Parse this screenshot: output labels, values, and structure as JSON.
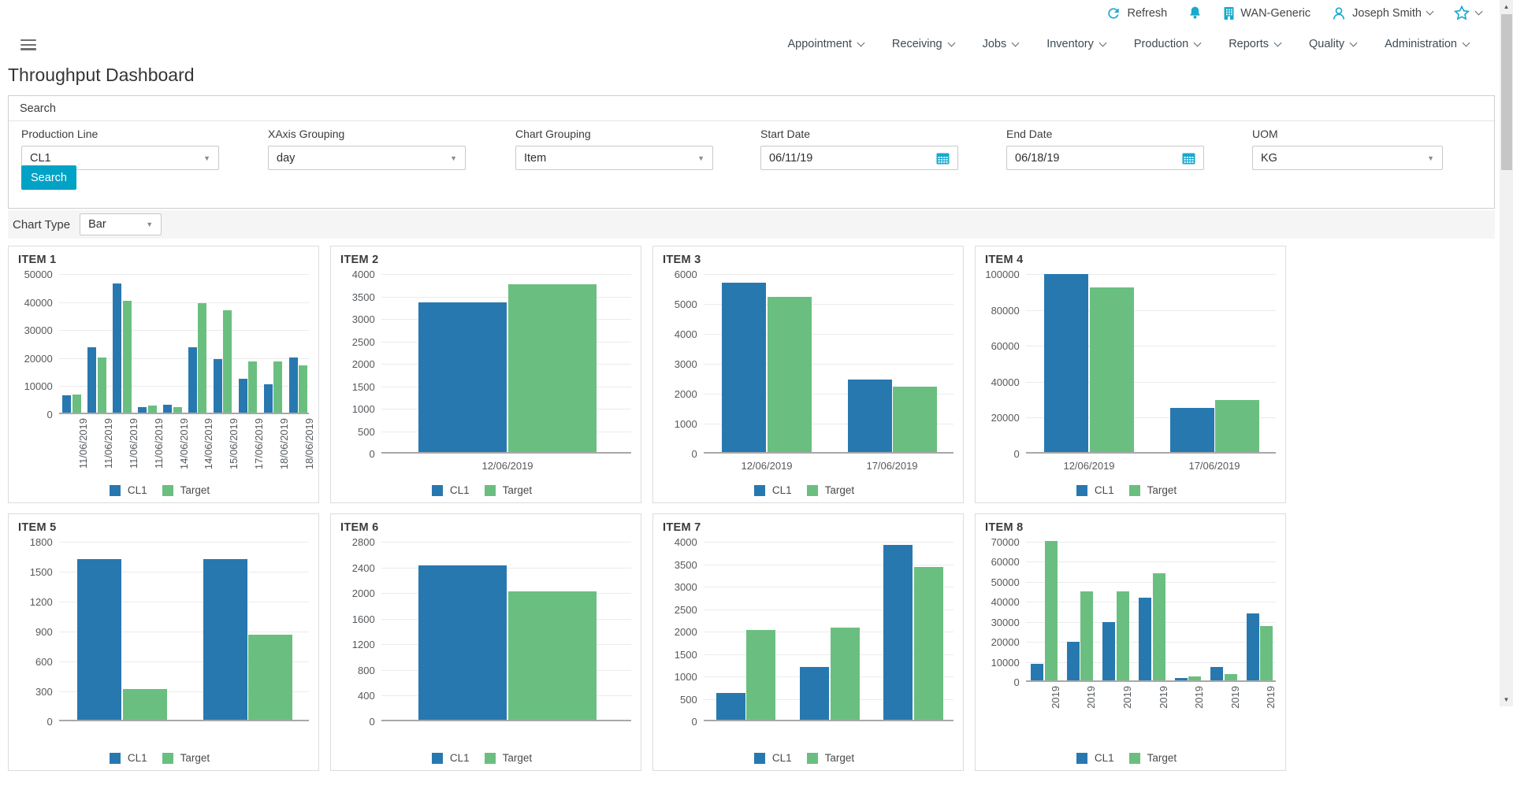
{
  "colors": {
    "accent": "#00a2c6",
    "bar_blue": "#2878b0",
    "bar_green": "#6abf80"
  },
  "topbar": {
    "refresh_label": "Refresh",
    "site_label": "WAN-Generic",
    "user_name": "Joseph Smith",
    "nav": [
      "Appointment",
      "Receiving",
      "Jobs",
      "Inventory",
      "Production",
      "Reports",
      "Quality",
      "Administration"
    ]
  },
  "page": {
    "title": "Throughput Dashboard"
  },
  "search_panel": {
    "header": "Search",
    "fields": [
      {
        "label": "Production Line",
        "value": "CL1",
        "type": "select"
      },
      {
        "label": "XAxis Grouping",
        "value": "day",
        "type": "select"
      },
      {
        "label": "Chart Grouping",
        "value": "Item",
        "type": "select"
      },
      {
        "label": "Start Date",
        "value": "06/11/19",
        "type": "date"
      },
      {
        "label": "End Date",
        "value": "06/18/19",
        "type": "date"
      },
      {
        "label": "UOM",
        "value": "KG",
        "type": "select"
      }
    ],
    "search_button": "Search"
  },
  "chart_type": {
    "label": "Chart Type",
    "value": "Bar"
  },
  "chart_data": [
    {
      "type": "bar",
      "title": "ITEM 1",
      "ylim": [
        0,
        50000
      ],
      "ystep": 10000,
      "rotated_labels": true,
      "grid": true,
      "legend_position": "bottom",
      "categories": [
        "11/06/2019",
        "11/06/2019",
        "11/06/2019",
        "11/06/2019",
        "14/06/2019",
        "14/06/2019",
        "15/06/2019",
        "17/06/2019",
        "18/06/2019",
        "18/06/2019"
      ],
      "series": [
        {
          "name": "CL1",
          "values": [
            6200,
            23200,
            46000,
            1900,
            2900,
            23400,
            19000,
            12000,
            10000,
            19800
          ]
        },
        {
          "name": "Target",
          "values": [
            6600,
            19800,
            39800,
            2600,
            2000,
            39100,
            36500,
            18300,
            18300,
            16800
          ]
        }
      ]
    },
    {
      "type": "bar",
      "title": "ITEM 2",
      "ylim": [
        0,
        4000
      ],
      "ystep": 500,
      "rotated_labels": false,
      "grid": true,
      "legend_position": "bottom",
      "categories": [
        "12/06/2019"
      ],
      "series": [
        {
          "name": "CL1",
          "values": [
            3330
          ]
        },
        {
          "name": "Target",
          "values": [
            3730
          ]
        }
      ]
    },
    {
      "type": "bar",
      "title": "ITEM 3",
      "ylim": [
        0,
        6000
      ],
      "ystep": 1000,
      "rotated_labels": false,
      "grid": true,
      "legend_position": "bottom",
      "categories": [
        "12/06/2019",
        "17/06/2019"
      ],
      "series": [
        {
          "name": "CL1",
          "values": [
            5650,
            2420
          ]
        },
        {
          "name": "Target",
          "values": [
            5180,
            2190
          ]
        }
      ]
    },
    {
      "type": "bar",
      "title": "ITEM 4",
      "ylim": [
        0,
        100000
      ],
      "ystep": 20000,
      "rotated_labels": false,
      "grid": true,
      "legend_position": "bottom",
      "categories": [
        "12/06/2019",
        "17/06/2019"
      ],
      "series": [
        {
          "name": "CL1",
          "values": [
            99000,
            24500
          ]
        },
        {
          "name": "Target",
          "values": [
            91500,
            29000
          ]
        }
      ]
    },
    {
      "type": "bar",
      "title": "ITEM 5",
      "ylim": [
        0,
        1800
      ],
      "ystep": 300,
      "rotated_labels": false,
      "grid": true,
      "legend_position": "bottom",
      "categories": [
        "",
        ""
      ],
      "series": [
        {
          "name": "CL1",
          "values": [
            1610,
            1610
          ]
        },
        {
          "name": "Target",
          "values": [
            305,
            850
          ]
        }
      ]
    },
    {
      "type": "bar",
      "title": "ITEM 6",
      "ylim": [
        0,
        2800
      ],
      "ystep": 400,
      "rotated_labels": false,
      "grid": true,
      "legend_position": "bottom",
      "categories": [
        ""
      ],
      "series": [
        {
          "name": "CL1",
          "values": [
            2410
          ]
        },
        {
          "name": "Target",
          "values": [
            2000
          ]
        }
      ]
    },
    {
      "type": "bar",
      "title": "ITEM 7",
      "ylim": [
        0,
        4000
      ],
      "ystep": 500,
      "rotated_labels": false,
      "grid": true,
      "legend_position": "bottom",
      "categories": [
        "",
        "",
        ""
      ],
      "series": [
        {
          "name": "CL1",
          "values": [
            600,
            1180,
            3900
          ]
        },
        {
          "name": "Target",
          "values": [
            2000,
            2050,
            3400
          ]
        }
      ]
    },
    {
      "type": "bar",
      "title": "ITEM 8",
      "ylim": [
        0,
        70000
      ],
      "ystep": 10000,
      "rotated_labels": true,
      "grid": true,
      "legend_position": "bottom",
      "categories": [
        "2019",
        "2019",
        "2019",
        "2019",
        "2019",
        "2019",
        "2019"
      ],
      "series": [
        {
          "name": "CL1",
          "values": [
            8200,
            19200,
            29000,
            41300,
            1300,
            6500,
            33400
          ]
        },
        {
          "name": "Target",
          "values": [
            69800,
            44400,
            44400,
            53400,
            1800,
            3000,
            27000
          ]
        }
      ]
    }
  ]
}
